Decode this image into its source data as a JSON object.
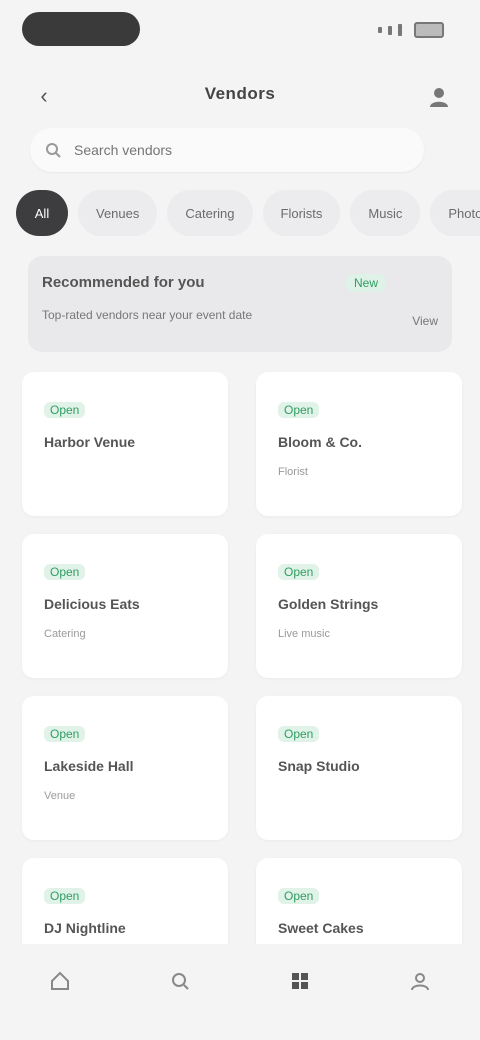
{
  "header": {
    "title": "Vendors"
  },
  "search": {
    "placeholder": "Search vendors"
  },
  "chips": [
    {
      "label": "All"
    },
    {
      "label": "Venues"
    },
    {
      "label": "Catering"
    },
    {
      "label": "Florists"
    },
    {
      "label": "Music"
    },
    {
      "label": "Photo"
    }
  ],
  "banner": {
    "title": "Recommended for you",
    "badge": "New",
    "text": "Top-rated vendors near your event date",
    "action": "View"
  },
  "cards": [
    {
      "tag": "Open",
      "title": "Harbor Venue",
      "subtitle": ""
    },
    {
      "tag": "Open",
      "title": "Bloom & Co.",
      "subtitle": "Florist"
    },
    {
      "tag": "Open",
      "title": "Delicious Eats",
      "subtitle": "Catering"
    },
    {
      "tag": "Open",
      "title": "Golden Strings",
      "subtitle": "Live music"
    },
    {
      "tag": "Open",
      "title": "Lakeside Hall",
      "subtitle": "Venue"
    },
    {
      "tag": "Open",
      "title": "Snap Studio",
      "subtitle": ""
    },
    {
      "tag": "Open",
      "title": "DJ Nightline",
      "subtitle": ""
    },
    {
      "tag": "Open",
      "title": "Sweet Cakes",
      "subtitle": ""
    }
  ],
  "nav": [
    {
      "icon": "home-icon",
      "label": ""
    },
    {
      "icon": "search-icon",
      "label": ""
    },
    {
      "icon": "grid-icon",
      "label": ""
    },
    {
      "icon": "profile-icon",
      "label": ""
    }
  ],
  "colors": {
    "accent": "#2f9d62",
    "chip_active": "#3d3d3f",
    "background": "#f4f4f5"
  }
}
